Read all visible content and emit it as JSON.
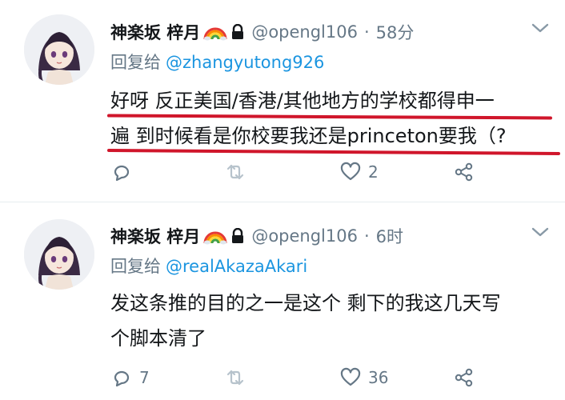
{
  "tweets": [
    {
      "display_name": "神楽坂 梓月",
      "handle": "@opengl106",
      "separator": "·",
      "time": "58分",
      "reply_label": "回复给",
      "reply_to": "@zhangyutong926",
      "text_lines": [
        "好呀 反正美国/香港/其他地方的学校都得申一",
        "遍 到时候看是你校要我还是princeton要我（?"
      ],
      "reply_count": "",
      "retweet_count": "",
      "like_count": "2"
    },
    {
      "display_name": "神楽坂 梓月",
      "handle": "@opengl106",
      "separator": "·",
      "time": "6时",
      "reply_label": "回复给",
      "reply_to": "@realAkazaAkari",
      "text_lines": [
        "发这条推的目的之一是这个 剩下的我这几天写",
        "个脚本清了"
      ],
      "reply_count": "7",
      "retweet_count": "",
      "like_count": "36"
    }
  ],
  "icons": {
    "reply": "reply-icon",
    "retweet": "retweet-icon",
    "like": "heart-icon",
    "share": "share-icon",
    "more": "chevron-down-icon",
    "protected": "lock-icon",
    "rainbow": "rainbow-flag-emoji"
  },
  "colors": {
    "mention": "#1b95e0",
    "secondary_text": "#657786",
    "highlight_underline": "#d0162b"
  }
}
